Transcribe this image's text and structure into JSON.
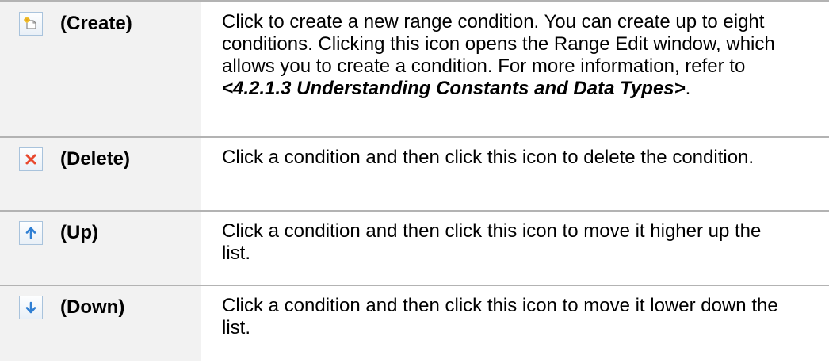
{
  "rows": [
    {
      "icon": "create-icon",
      "label": "(Create)",
      "desc_before": "Click to create a new range condition. You can create up to eight conditions. Clicking this icon opens the Range Edit window, which allows you to create a condition. For more information, refer to ",
      "desc_ref": "<4.2.1.3 Understanding Constants and Data Types>",
      "desc_after": "."
    },
    {
      "icon": "delete-icon",
      "label": "(Delete)",
      "desc": "Click a condition and then click this icon to delete the condition."
    },
    {
      "icon": "arrow-up-icon",
      "label": "(Up)",
      "desc": "Click a condition and then click this icon to move it higher up the list."
    },
    {
      "icon": "arrow-down-icon",
      "label": "(Down)",
      "desc": "Click a condition and then click this icon to move it lower down the list."
    }
  ],
  "colors": {
    "rule": "#b3b3b3",
    "left_cell_bg": "#f2f2f2",
    "icon_border": "#a9c3dc",
    "delete_x": "#e8492f",
    "arrow_blue": "#2f7fd3"
  }
}
